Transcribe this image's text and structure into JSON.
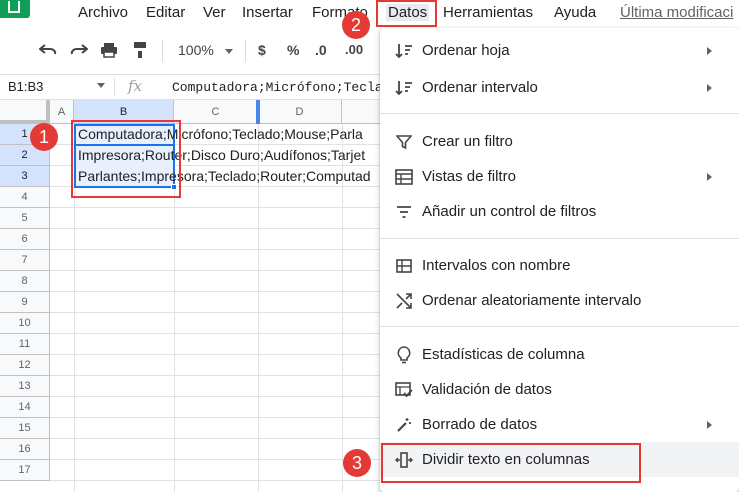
{
  "menubar": {
    "items": [
      "Archivo",
      "Editar",
      "Ver",
      "Insertar",
      "Formato",
      "Datos",
      "Herramientas",
      "Ayuda",
      "Última modificaci"
    ]
  },
  "toolbar": {
    "zoom": "100%",
    "currency": "$",
    "percent": "%",
    "decimal": ".0",
    "decimal_more": ".00"
  },
  "formula_bar": {
    "name_box": "B1:B3",
    "fx": "fx",
    "content": "Computadora;Micrófono;Tecla"
  },
  "grid": {
    "columns": [
      "A",
      "B",
      "C",
      "D"
    ],
    "rows": [
      "1",
      "2",
      "3",
      "4",
      "5",
      "6",
      "7",
      "8",
      "9",
      "10",
      "11",
      "12",
      "13",
      "14",
      "15",
      "16",
      "17"
    ],
    "cells": [
      "Computadora;Micrófono;Teclado;Mouse;Parla",
      "Impresora;Router;Disco Duro;Audífonos;Tarjet",
      "Parlantes;Impresora;Teclado;Router;Computad"
    ]
  },
  "dropdown": {
    "items": [
      {
        "label": "Ordenar hoja",
        "icon": "sort-icon",
        "arrow": true
      },
      {
        "label": "Ordenar intervalo",
        "icon": "sort-icon",
        "arrow": true
      },
      {
        "label": "Crear un filtro",
        "icon": "filter-icon",
        "arrow": false
      },
      {
        "label": "Vistas de filtro",
        "icon": "filter-views-icon",
        "arrow": true
      },
      {
        "label": "Añadir un control de filtros",
        "icon": "filter-control-icon",
        "arrow": false
      },
      {
        "label": "Intervalos con nombre",
        "icon": "named-ranges-icon",
        "arrow": false
      },
      {
        "label": "Ordenar aleatoriamente intervalo",
        "icon": "shuffle-icon",
        "arrow": false
      },
      {
        "label": "Estadísticas de columna",
        "icon": "lightbulb-icon",
        "arrow": false
      },
      {
        "label": "Validación de datos",
        "icon": "validation-icon",
        "arrow": false
      },
      {
        "label": "Borrado de datos",
        "icon": "magic-wand-icon",
        "arrow": true
      },
      {
        "label": "Dividir texto en columnas",
        "icon": "split-columns-icon",
        "arrow": false
      }
    ]
  },
  "annotations": {
    "step1": "1",
    "step2": "2",
    "step3": "3",
    "color": "#e53935"
  },
  "colors": {
    "selection": "#1a73e8",
    "header_selected": "#d3e3fd",
    "brand": "#0f9d58"
  }
}
